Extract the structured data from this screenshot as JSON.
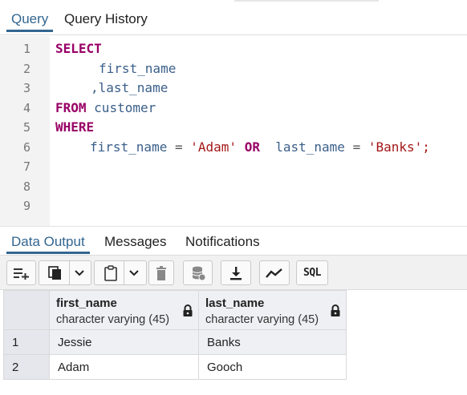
{
  "query_tabs": [
    {
      "label": "Query",
      "active": true
    },
    {
      "label": "Query History",
      "active": false
    }
  ],
  "editor": {
    "line_numbers": [
      "1",
      "2",
      "3",
      "4",
      "5",
      "6",
      "7",
      "8",
      "9"
    ],
    "tokens": {
      "select": "SELECT",
      "first_name": "first_name",
      "comma_last_name": ",last_name",
      "from": "FROM",
      "customer": "customer",
      "where": "WHERE",
      "w_first_name": "first_name",
      "eq1": "=",
      "adam": "'Adam'",
      "or": "OR",
      "w_last_name": "last_name",
      "eq2": "=",
      "banks": "'Banks';"
    }
  },
  "output_tabs": [
    {
      "label": "Data Output",
      "active": true
    },
    {
      "label": "Messages",
      "active": false
    },
    {
      "label": "Notifications",
      "active": false
    }
  ],
  "toolbar": {
    "icons": [
      "add-row-icon",
      "copy-icon",
      "chevron-down-icon",
      "paste-icon",
      "chevron-down-icon",
      "delete-icon",
      "save-data-icon",
      "download-icon",
      "graph-icon"
    ],
    "sql_label": "SQL"
  },
  "grid": {
    "columns": [
      {
        "name": "first_name",
        "type": "character varying (45)"
      },
      {
        "name": "last_name",
        "type": "character varying (45)"
      }
    ],
    "rows": [
      {
        "num": "1",
        "cells": [
          "Jessie",
          "Banks"
        ]
      },
      {
        "num": "2",
        "cells": [
          "Adam",
          "Gooch"
        ]
      }
    ]
  },
  "colors": {
    "accent": "#326690",
    "keyword": "#990066",
    "string": "#a41717",
    "identifier": "#3a5f8a"
  }
}
